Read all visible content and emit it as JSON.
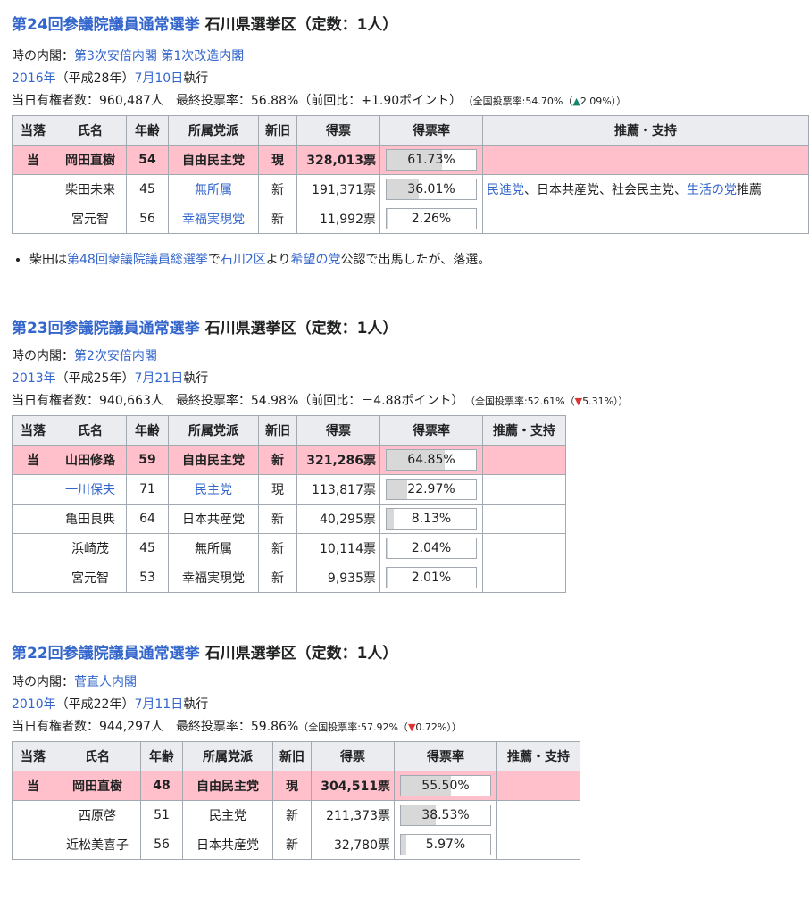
{
  "s24": {
    "title_link": "第24回参議院議員通常選挙",
    "title_rest": " 石川県選挙区（定数：1人）",
    "cabinet_label": "時の内閣：",
    "cabinet1": "第3次安倍内閣",
    "cabinet2": "第1次改造内閣",
    "year_link": "2016年",
    "era": "（平成28年）",
    "date_link": "7月10日",
    "exec": "執行",
    "voters": "当日有権者数：960,487人　最終投票率：56.88%（前回比：+1.90ポイント）",
    "national": "（全国投票率:54.70%（",
    "national_arrow": "▲",
    "national_delta": "2.09%））",
    "headers": [
      "当落",
      "氏名",
      "年齢",
      "所属党派",
      "新旧",
      "得票",
      "得票率",
      "推薦・支持"
    ],
    "rows": [
      {
        "result": "当",
        "name": "岡田直樹",
        "age": "54",
        "party": "自由民主党",
        "status": "現",
        "votes": "328,013票",
        "rate": "61.73%",
        "rate_v": 61.73,
        "support": ""
      },
      {
        "result": "",
        "name": "柴田未来",
        "age": "45",
        "party": "無所属",
        "status": "新",
        "votes": "191,371票",
        "rate": "36.01%",
        "rate_v": 36.01,
        "support_a": "民進党",
        "support_b": "、日本共産党、社会民主党、",
        "support_c": "生活の党",
        "support_d": "推薦"
      },
      {
        "result": "",
        "name": "宮元智",
        "age": "56",
        "party": "幸福実現党",
        "status": "新",
        "votes": "11,992票",
        "rate": "2.26%",
        "rate_v": 2.26,
        "support": ""
      }
    ],
    "note_a": "柴田は",
    "note_link1": "第48回衆議院議員総選挙",
    "note_b": "で",
    "note_link2": "石川2区",
    "note_c": "より",
    "note_link3": "希望の党",
    "note_d": "公認で出馬したが、落選。"
  },
  "s23": {
    "title_link": "第23回参議院議員通常選挙",
    "title_rest": " 石川県選挙区（定数：1人）",
    "cabinet_label": "時の内閣：",
    "cabinet1": "第2次安倍内閣",
    "year_link": "2013年",
    "era": "（平成25年）",
    "date_link": "7月21日",
    "exec": "執行",
    "voters": "当日有権者数：940,663人　最終投票率：54.98%（前回比：－4.88ポイント）",
    "national": "（全国投票率:52.61%（",
    "national_arrow": "▼",
    "national_delta": "5.31%））",
    "headers": [
      "当落",
      "氏名",
      "年齢",
      "所属党派",
      "新旧",
      "得票",
      "得票率",
      "推薦・支持"
    ],
    "rows": [
      {
        "result": "当",
        "name": "山田修路",
        "age": "59",
        "party": "自由民主党",
        "status": "新",
        "votes": "321,286票",
        "rate": "64.85%",
        "rate_v": 64.85
      },
      {
        "result": "",
        "name": "一川保夫",
        "age": "71",
        "party": "民主党",
        "status": "現",
        "votes": "113,817票",
        "rate": "22.97%",
        "rate_v": 22.97
      },
      {
        "result": "",
        "name": "亀田良典",
        "age": "64",
        "party": "日本共産党",
        "status": "新",
        "votes": "40,295票",
        "rate": "8.13%",
        "rate_v": 8.13
      },
      {
        "result": "",
        "name": "浜崎茂",
        "age": "45",
        "party": "無所属",
        "status": "新",
        "votes": "10,114票",
        "rate": "2.04%",
        "rate_v": 2.04
      },
      {
        "result": "",
        "name": "宮元智",
        "age": "53",
        "party": "幸福実現党",
        "status": "新",
        "votes": "9,935票",
        "rate": "2.01%",
        "rate_v": 2.01
      }
    ]
  },
  "s22": {
    "title_link": "第22回参議院議員通常選挙",
    "title_rest": " 石川県選挙区（定数：1人）",
    "cabinet_label": "時の内閣：",
    "cabinet1": "菅直人内閣",
    "year_link": "2010年",
    "era": "（平成22年）",
    "date_link": "7月11日",
    "exec": "執行",
    "voters": "当日有権者数：944,297人　最終投票率：59.86%",
    "national": "（全国投票率:57.92%（",
    "national_arrow": "▼",
    "national_delta": "0.72%））",
    "headers": [
      "当落",
      "氏名",
      "年齢",
      "所属党派",
      "新旧",
      "得票",
      "得票率",
      "推薦・支持"
    ],
    "rows": [
      {
        "result": "当",
        "name": "岡田直樹",
        "age": "48",
        "party": "自由民主党",
        "status": "現",
        "votes": "304,511票",
        "rate": "55.50%",
        "rate_v": 55.5
      },
      {
        "result": "",
        "name": "西原啓",
        "age": "51",
        "party": "民主党",
        "status": "新",
        "votes": "211,373票",
        "rate": "38.53%",
        "rate_v": 38.53
      },
      {
        "result": "",
        "name": "近松美喜子",
        "age": "56",
        "party": "日本共産党",
        "status": "新",
        "votes": "32,780票",
        "rate": "5.97%",
        "rate_v": 5.97
      }
    ]
  }
}
